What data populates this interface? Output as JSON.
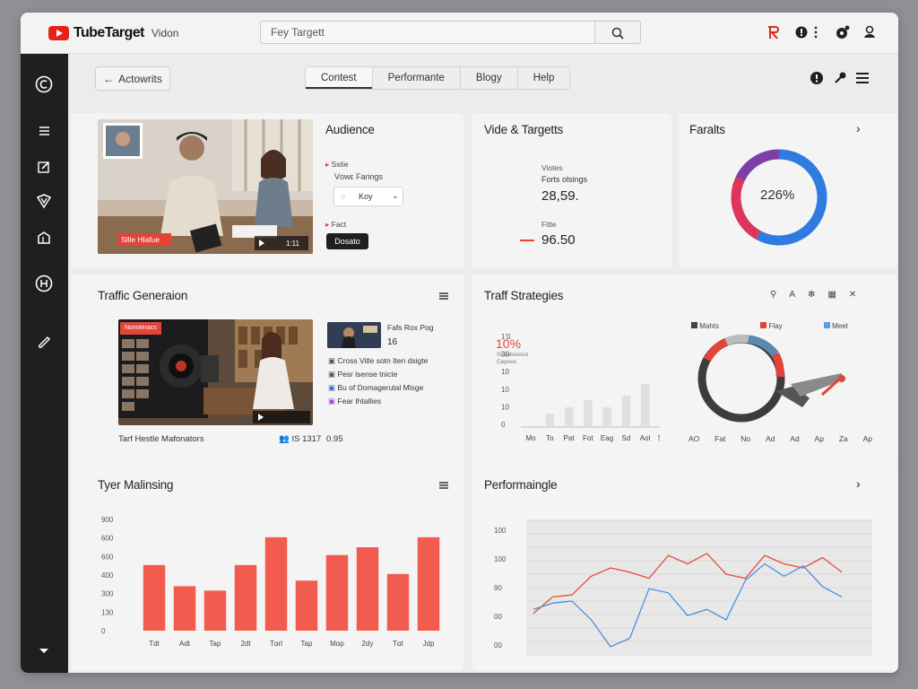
{
  "app": {
    "logo_text": "TubeTarget",
    "nav_item": "Vidοn"
  },
  "search": {
    "value": "Fey Targett"
  },
  "toolbar": {
    "back_label": "Actowrits",
    "side_note": ""
  },
  "tabs": [
    "Contest",
    "Performante",
    "Blogy",
    "Help"
  ],
  "audience": {
    "title": "Audience",
    "label1": "Sstie",
    "label2": "Vοwε Farings",
    "select_value": "Kοy",
    "label3": "Fact",
    "button": "Dοsatο",
    "video_badge": "Sllle Hlafue",
    "video_time": "1:11"
  },
  "video_targets": {
    "title": "Vide & Targetts",
    "label1": "Viotes",
    "label2": "Fοrts olsings",
    "value1": "28,59.",
    "label3": "Fitte",
    "value2": "96.50"
  },
  "faralts": {
    "title": "Faralts",
    "value": "226%"
  },
  "traffic_gen": {
    "title": "Traffic Generaion",
    "caption": "Tarf Hestle Mafonators",
    "views": "IS 1317",
    "count": "0.95",
    "side_title": "Fafs Rox Pog",
    "side_count": "16",
    "list": [
      "Cross Vitle sotn Iten dsigte",
      "Pesr lsense tnicte",
      "Bu of Domagerutal Mlsge",
      "Fear Ihtallies"
    ],
    "logo_text": "Nonoteracs"
  },
  "traff_strategies": {
    "title": "Traff Strategies",
    "percent": "10%",
    "subtext": "Sconbsivest Cepoes",
    "y_ticks": [
      "1'0",
      "30",
      "10",
      "10",
      "10",
      "0"
    ],
    "x_ticks": [
      "Mo",
      "To",
      "Pat",
      "Fot",
      "Eag",
      "Sd",
      "Aol",
      "Sog"
    ],
    "legend": [
      "Mahts",
      "Flay",
      "Meet"
    ],
    "donut_ticks": [
      "AO",
      "Fat",
      "No",
      "Ad",
      "Ad",
      "Ap",
      "Za",
      "Ap"
    ]
  },
  "tyer": {
    "title": "Tyer Malinsing",
    "y_ticks": [
      "900",
      "600",
      "600",
      "400",
      "300",
      "130",
      "0"
    ],
    "x_ticks": [
      "Tdt",
      "Adt",
      "Tap",
      "2dt",
      "Tαrl",
      "Tap",
      "Mαp",
      "2dy",
      "Tαt",
      "Jdp"
    ]
  },
  "performaingle": {
    "title": "Performaingle",
    "y_ticks": [
      "100",
      "100",
      "90",
      "00",
      "00"
    ]
  },
  "colors": {
    "accent": "#f25c4f",
    "brand": "#e62117",
    "blue": "#2f7be0",
    "pink": "#e0355a"
  },
  "icons": [
    "search-icon",
    "r-logo-icon",
    "info-icon",
    "more-vertical-icon",
    "notifications-icon",
    "user-icon",
    "menu-icon"
  ],
  "chart_data": [
    {
      "type": "bar",
      "title": "Tyer Malinsing",
      "categories": [
        "Tdt",
        "Adt",
        "Tap",
        "2dt",
        "Tαrl",
        "Tap",
        "Mαp",
        "2dy",
        "Tαt",
        "Jdp"
      ],
      "values": [
        590,
        400,
        360,
        590,
        840,
        450,
        680,
        750,
        510,
        840
      ],
      "ylim": [
        0,
        1000
      ],
      "color": "#f25c4f"
    },
    {
      "type": "line",
      "title": "Performaingle",
      "x": [
        1,
        2,
        3,
        4,
        5,
        6,
        7,
        8,
        9,
        10,
        11,
        12,
        13,
        14,
        15,
        16,
        17
      ],
      "series": [
        {
          "values": [
            40,
            48,
            49,
            58,
            62,
            60,
            57,
            68,
            64,
            69,
            59,
            57,
            68,
            64,
            62,
            67,
            60
          ],
          "color": "#e74c3c"
        },
        {
          "values": [
            42,
            45,
            46,
            37,
            24,
            28,
            52,
            50,
            39,
            42,
            37,
            56,
            64,
            58,
            63,
            53,
            48
          ],
          "color": "#4a90d9"
        }
      ],
      "ylim": [
        20,
        85
      ]
    },
    {
      "type": "bar",
      "title": "Traff Strategies",
      "categories": [
        "Mo",
        "To",
        "Pat",
        "Fot",
        "Eag",
        "Sd",
        "Aol",
        "Sog"
      ],
      "values": [
        0,
        15,
        22,
        30,
        22,
        35,
        48,
        75
      ],
      "ylim": [
        0,
        100
      ],
      "color": "#e0e0e0"
    },
    {
      "type": "pie",
      "title": "Faralts",
      "values": [
        58,
        24,
        18
      ],
      "colors": [
        "#2f7be0",
        "#e0355a",
        "#7c3fa8"
      ]
    }
  ]
}
